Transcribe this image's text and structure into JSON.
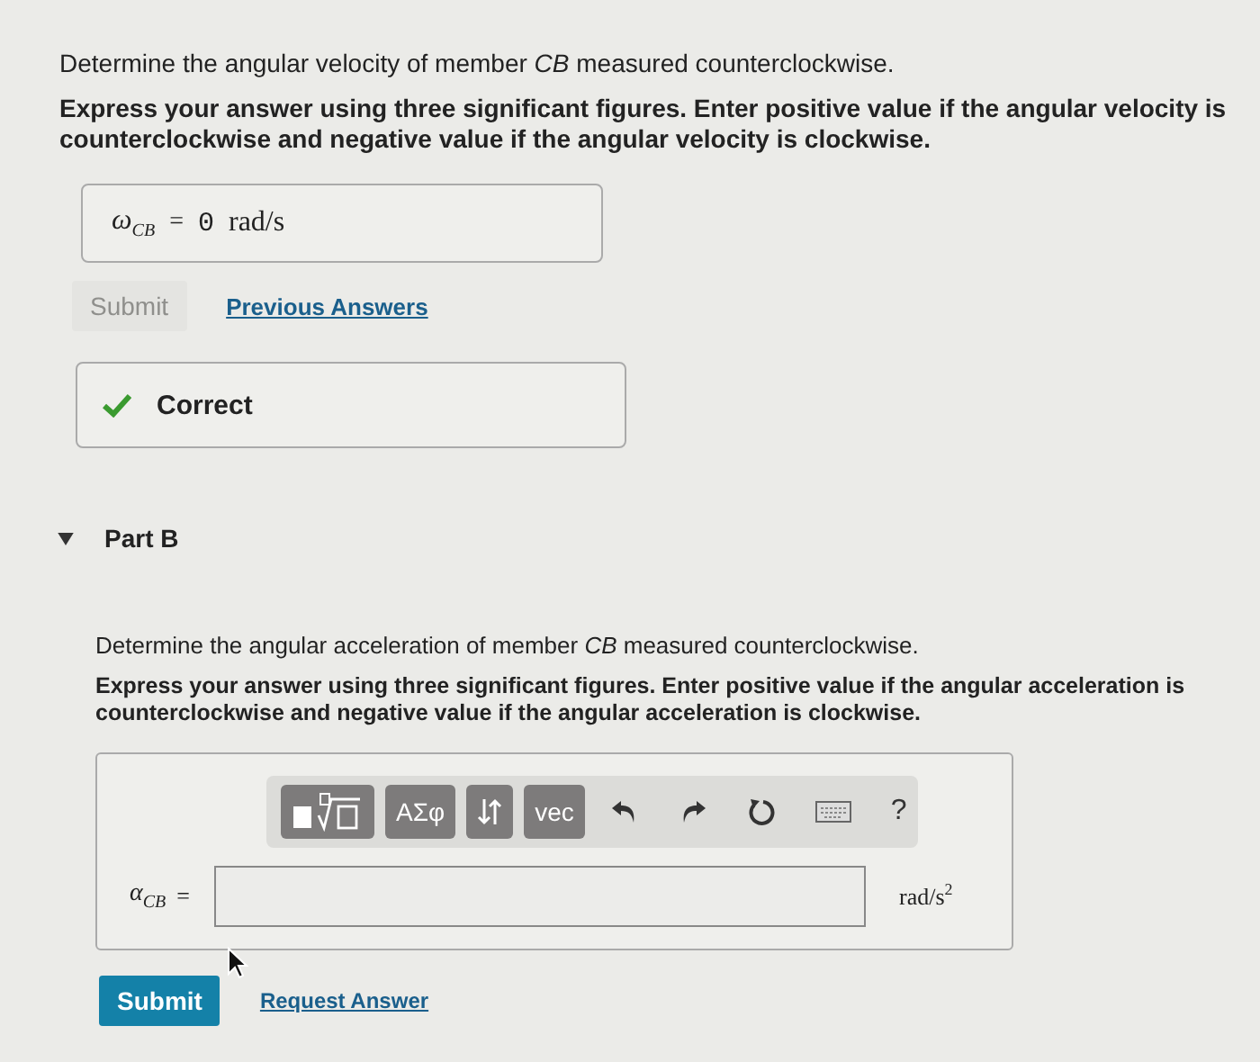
{
  "part_a": {
    "prompt": "Determine the angular velocity of member *CB* measured counterclockwise.",
    "instructions": "Express your answer using three significant figures. Enter positive value if the angular velocity is counterclockwise and negative value if the angular velocity is clockwise.",
    "answer": {
      "variable": "ω$_{CB}$",
      "equals": "=",
      "value": "0",
      "unit": "rad/s"
    },
    "submit": {
      "label": "Submit",
      "disabled": true
    },
    "link": "Previous Answers",
    "feedback": {
      "text": "Correct",
      "correct": true
    }
  },
  "part_b": {
    "header": {
      "label": "Part B",
      "expanded": true
    },
    "prompt": "Determine the angular acceleration of member *CB* measured counterclockwise.",
    "instructions": "Express your answer using three significant figures. Enter positive value if the angular acceleration is counterclockwise and negative value if the angular acceleration is clockwise.",
    "toolbar": [
      {
        "kind": "templates"
      },
      {
        "kind": "text",
        "label": "ΑΣφ"
      },
      {
        "kind": "sort"
      },
      {
        "kind": "text",
        "label": "vec"
      },
      {
        "kind": "undo"
      },
      {
        "kind": "redo"
      },
      {
        "kind": "reset"
      },
      {
        "kind": "keyboard"
      },
      {
        "kind": "help",
        "label": "?"
      }
    ],
    "answer": {
      "variable": "α$_{CB}$",
      "equals": "=",
      "unit": "rad/s$^{2}$"
    },
    "submit": {
      "label": "Submit",
      "disabled": false
    },
    "link": "Request Answer"
  }
}
